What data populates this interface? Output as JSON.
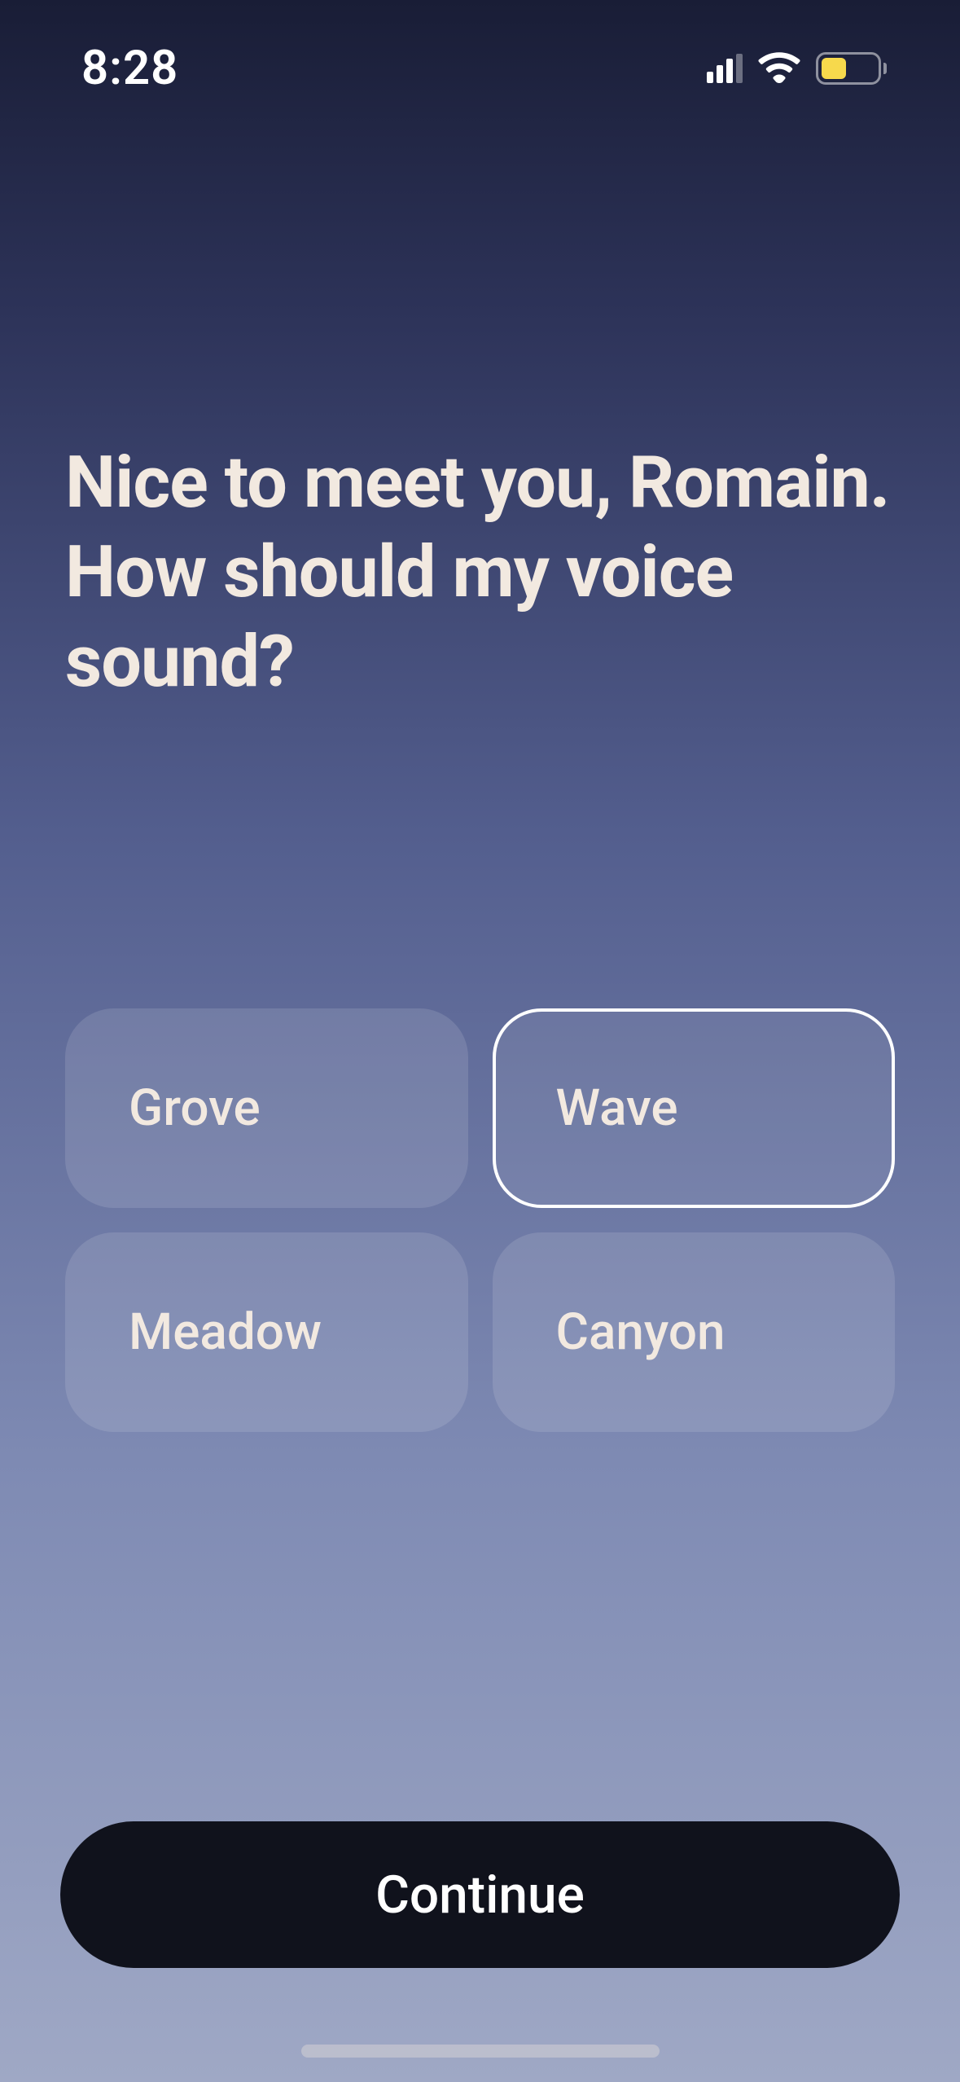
{
  "status": {
    "time": "8:28"
  },
  "heading": "Nice to meet you, Romain. How should my voice sound?",
  "options": [
    {
      "label": "Grove",
      "selected": false
    },
    {
      "label": "Wave",
      "selected": true
    },
    {
      "label": "Meadow",
      "selected": false
    },
    {
      "label": "Canyon",
      "selected": false
    }
  ],
  "continue_label": "Continue"
}
